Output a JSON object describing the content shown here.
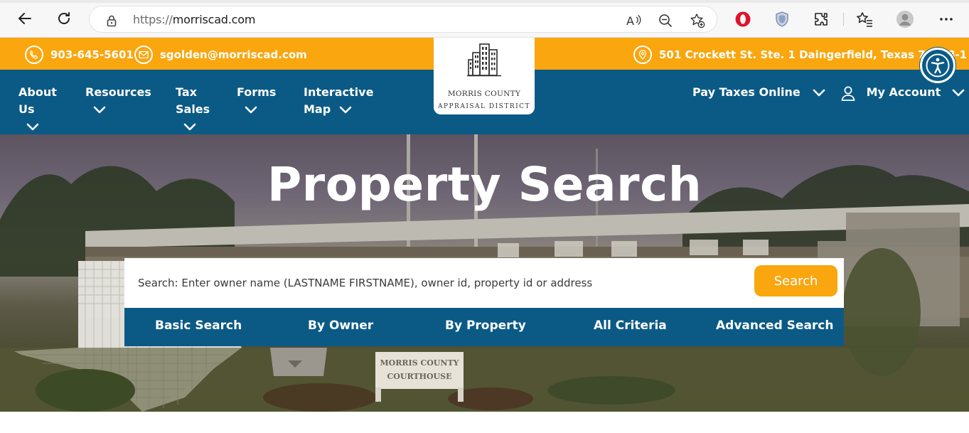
{
  "browser": {
    "url_protocol": "https://",
    "url_host": "morriscad.com",
    "icons": [
      "back-icon",
      "refresh-icon",
      "lock-icon",
      "read-aloud-icon",
      "zoom-out-icon",
      "add-favorite-icon",
      "opera-extension-icon",
      "shield-extension-icon",
      "extensions-icon",
      "favorites-icon",
      "profile-icon",
      "more-icon"
    ]
  },
  "top_bar": {
    "phone": "903-645-5601",
    "email": "sgolden@morriscad.com",
    "address": "501 Crockett St. Ste. 1 Daingerfield, Texas 75638-1"
  },
  "logo": {
    "line1": "MORRIS COUNTY",
    "line2": "APPRAISAL DISTRICT"
  },
  "nav": {
    "about_line1": "About",
    "about_line2": "Us",
    "resources": "Resources",
    "tax_line1": "Tax",
    "tax_line2": "Sales",
    "forms": "Forms",
    "map_line1": "Interactive",
    "map_line2": "Map",
    "pay_taxes": "Pay Taxes Online",
    "my_account": "My Account"
  },
  "hero": {
    "title": "Property Search",
    "search_placeholder": "Search: Enter owner name (LASTNAME FIRSTNAME), owner id, property id or address",
    "search_button": "Search",
    "tabs": [
      "Basic Search",
      "By Owner",
      "By Property",
      "All Criteria",
      "Advanced Search"
    ],
    "sign_text_line1": "MORRIS COUNTY",
    "sign_text_line2": "COURTHOUSE"
  },
  "colors": {
    "accent_orange": "#f9a60f",
    "nav_blue": "#0b5a86"
  }
}
